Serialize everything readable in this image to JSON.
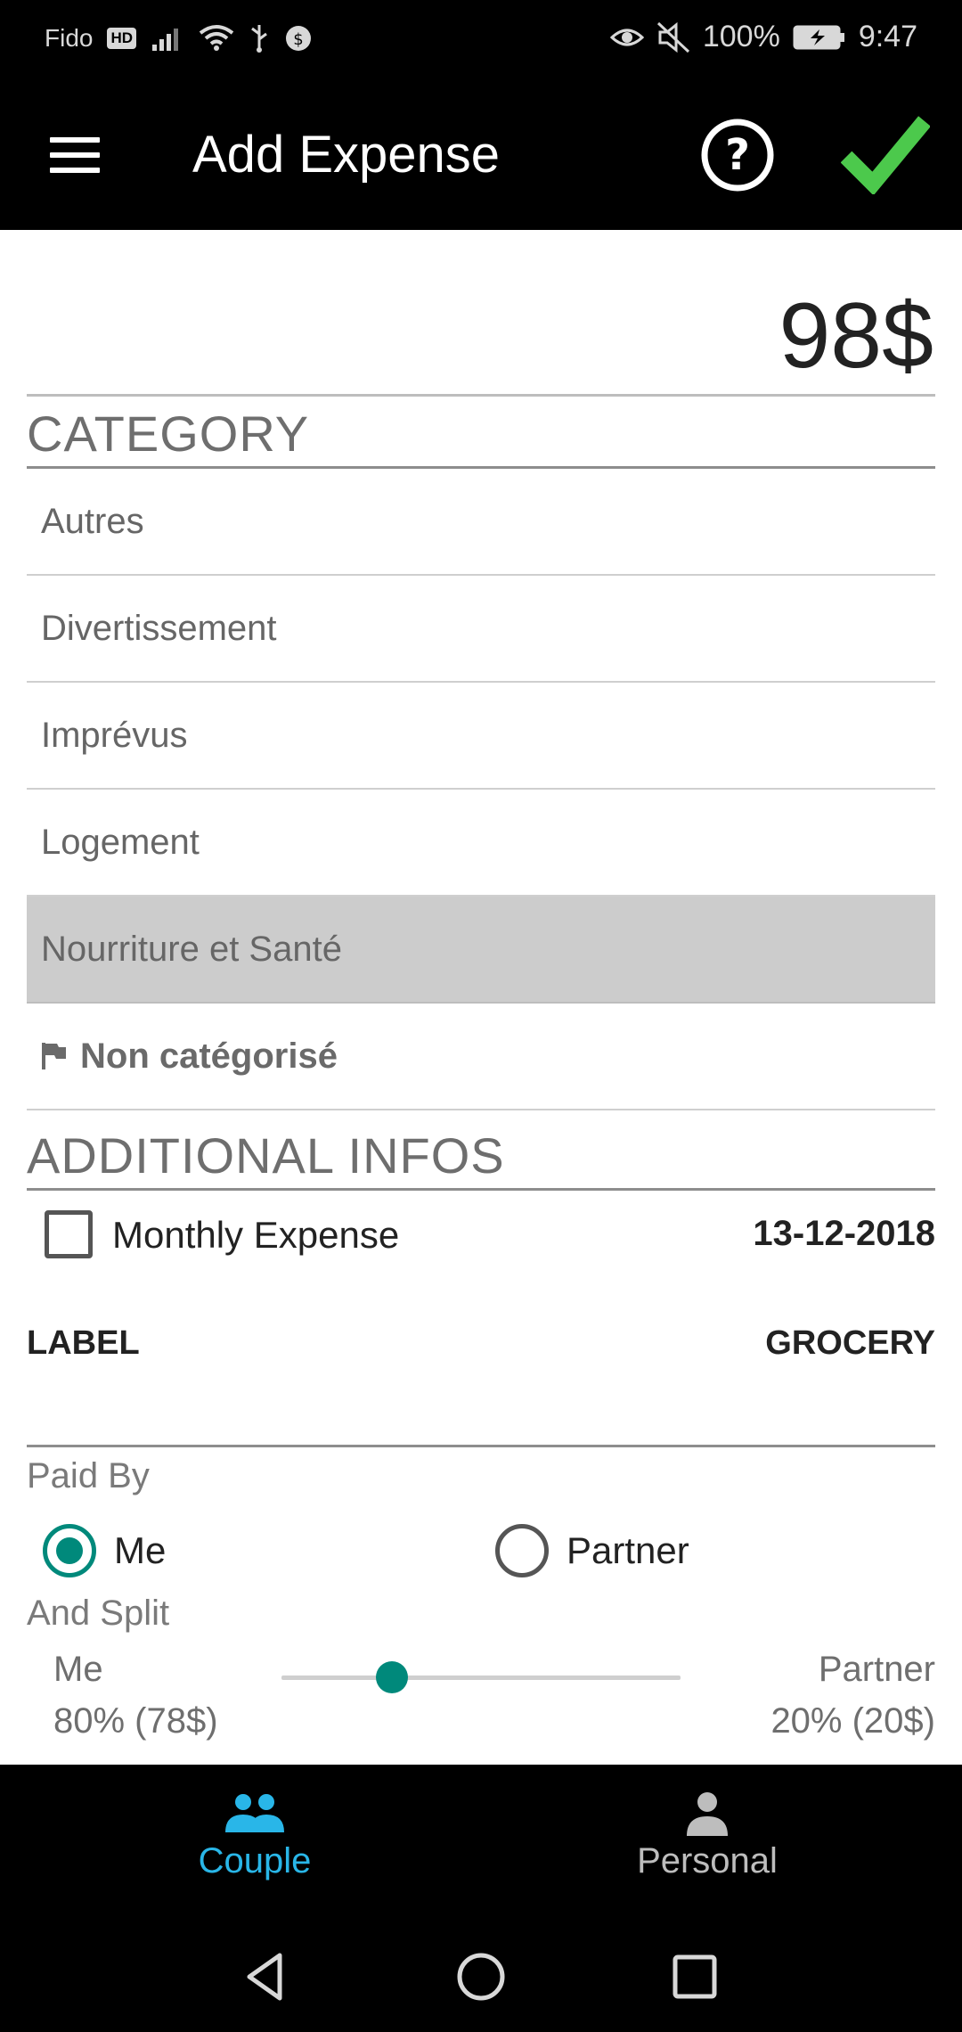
{
  "status_bar": {
    "carrier": "Fido",
    "hd_badge": "HD",
    "battery": "100%",
    "time": "9:47"
  },
  "app_bar": {
    "title": "Add Expense",
    "icons": [
      "menu-icon",
      "help-icon",
      "check-icon"
    ]
  },
  "amount": "98$",
  "category": {
    "header": "CATEGORY",
    "items": [
      {
        "label": "Autres",
        "selected": false
      },
      {
        "label": "Divertissement",
        "selected": false
      },
      {
        "label": "Imprévus",
        "selected": false
      },
      {
        "label": "Logement",
        "selected": false
      },
      {
        "label": "Nourriture et Santé",
        "selected": true
      },
      {
        "label": "Non catégorisé",
        "selected": false
      }
    ]
  },
  "additional": {
    "header": "ADDITIONAL INFOS",
    "monthly_label": "Monthly Expense",
    "monthly_checked": false,
    "date": "13-12-2018",
    "label_key": "LABEL",
    "label_value": "GROCERY",
    "paid_by_label": "Paid By",
    "paid_by_options": [
      "Me",
      "Partner"
    ],
    "paid_by_selected": "Me",
    "split_label": "And Split",
    "split_me_name": "Me",
    "split_me_value": "80% (78$)",
    "split_partner_name": "Partner",
    "split_partner_value": "20% (20$)",
    "split_partner_fraction": 0.2
  },
  "bottom_nav": {
    "couple_label": "Couple",
    "personal_label": "Personal",
    "active": "Couple"
  },
  "colors": {
    "accent": "#00897b",
    "nav_active": "#29b6e8",
    "confirm": "#4cc94c"
  }
}
